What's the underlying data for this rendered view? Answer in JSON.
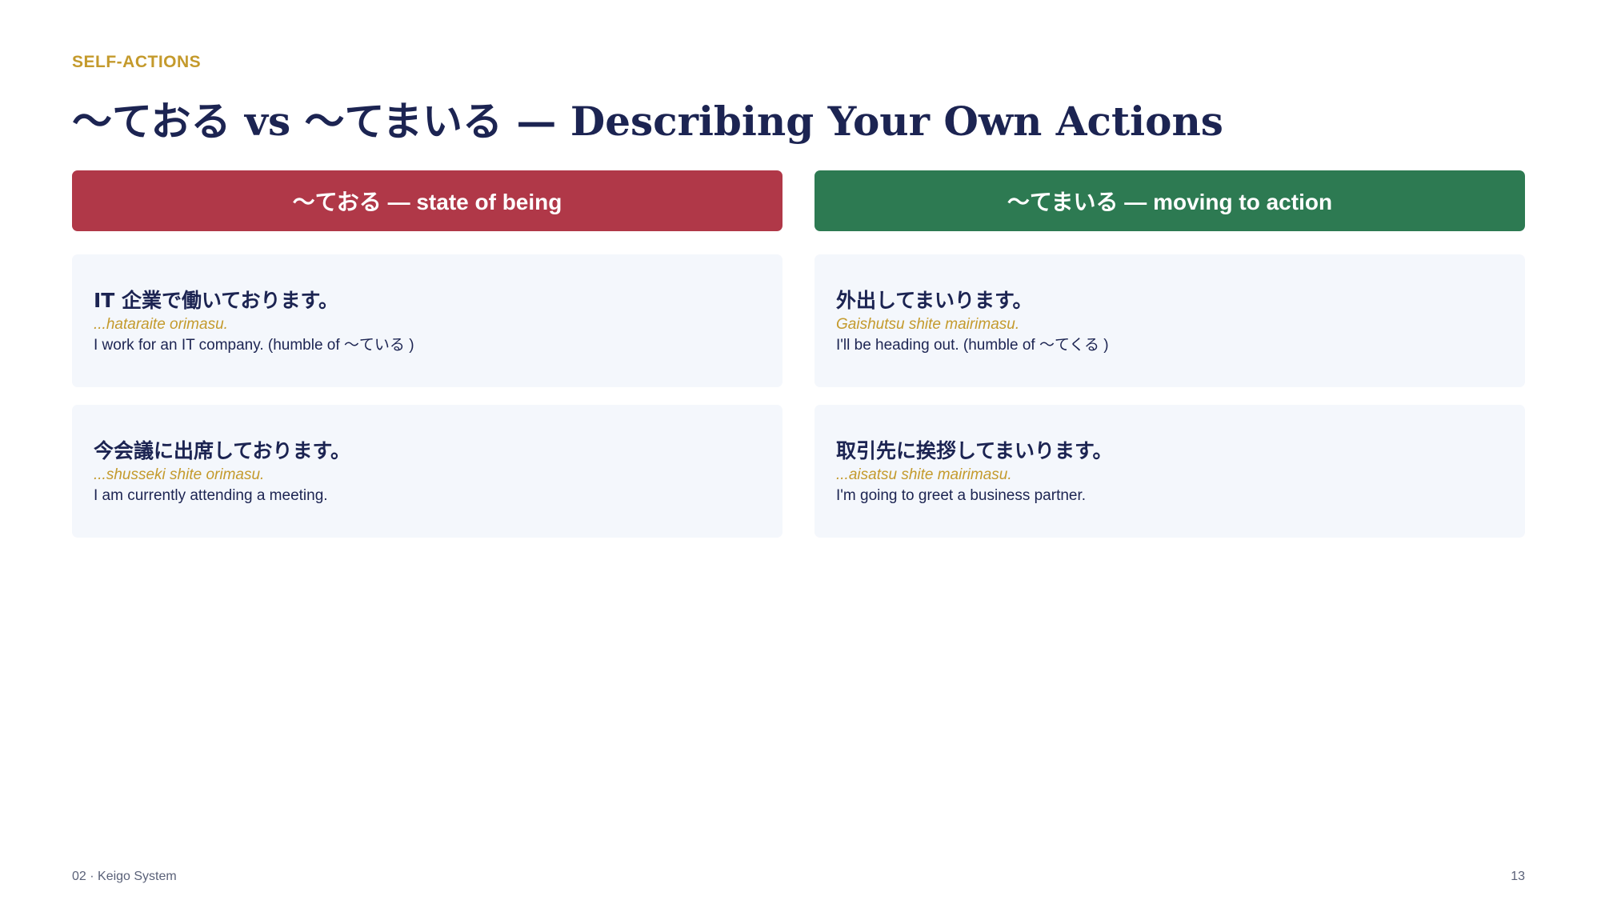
{
  "eyebrow": "SELF-ACTIONS",
  "title": "〜ておる  vs  〜てまいる —  Describing Your Own Actions",
  "columns": [
    {
      "header": "〜ておる —  state of being",
      "color": "#b03848",
      "examples": [
        {
          "japanese": "IT 企業で働いております。",
          "romaji": "...hataraite orimasu.",
          "english": "I work for an IT company. (humble of  〜ている )"
        },
        {
          "japanese": "今会議に出席しております。",
          "romaji": "...shusseki shite orimasu.",
          "english": "I am currently attending a meeting."
        }
      ]
    },
    {
      "header": "〜てまいる —  moving to action",
      "color": "#2d7a52",
      "examples": [
        {
          "japanese": "外出してまいります。",
          "romaji": "Gaishutsu shite mairimasu.",
          "english": "I'll be heading out. (humble of  〜てくる )"
        },
        {
          "japanese": "取引先に挨拶してまいります。",
          "romaji": "...aisatsu shite mairimasu.",
          "english": "I'm going to greet a business partner."
        }
      ]
    }
  ],
  "footer": {
    "section": "02 · Keigo System",
    "page_number": "13"
  },
  "colors": {
    "accent_gold": "#c49a2c",
    "navy": "#1c2452",
    "card_bg": "#f4f7fc"
  }
}
